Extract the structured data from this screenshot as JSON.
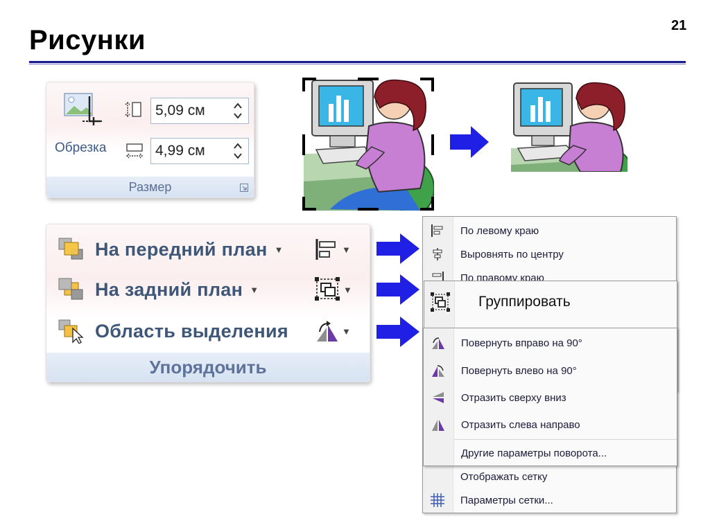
{
  "slide": {
    "title": "Рисунки",
    "number": "21"
  },
  "size_group": {
    "crop_label": "Обрезка",
    "height_value": "5,09 см",
    "width_value": "4,99 см",
    "footer_label": "Размер"
  },
  "arrange_group": {
    "bring_forward": "На передний план",
    "send_backward": "На задний план",
    "selection_pane": "Область выделения",
    "footer_label": "Упорядочить"
  },
  "align_menu": {
    "items": [
      {
        "label": "По левому краю",
        "icon": "align-left-icon"
      },
      {
        "label": "Выровнять по центру",
        "icon": "align-center-icon"
      },
      {
        "label": "По правому краю",
        "icon": "align-right-icon"
      }
    ],
    "bottom_items": [
      {
        "label": "Отображать сетку",
        "icon": ""
      },
      {
        "label": "Параметры сетки...",
        "icon": "grid-icon"
      }
    ]
  },
  "group_menu": {
    "label": "Группировать",
    "icon": "group-icon"
  },
  "rotate_menu": {
    "items": [
      {
        "label": "Повернуть вправо на 90°",
        "icon": "rotate-right-icon"
      },
      {
        "label": "Повернуть влево на 90°",
        "icon": "rotate-left-icon"
      },
      {
        "label": "Отразить сверху вниз",
        "icon": "flip-vertical-icon"
      },
      {
        "label": "Отразить слева направо",
        "icon": "flip-horizontal-icon"
      }
    ],
    "more_label": "Другие параметры поворота..."
  },
  "colors": {
    "title_rule": "#1a1a8c",
    "arrow_blue": "#1f1fe6",
    "ribbon_text": "#3e5678",
    "footer_text": "#5f7299"
  }
}
